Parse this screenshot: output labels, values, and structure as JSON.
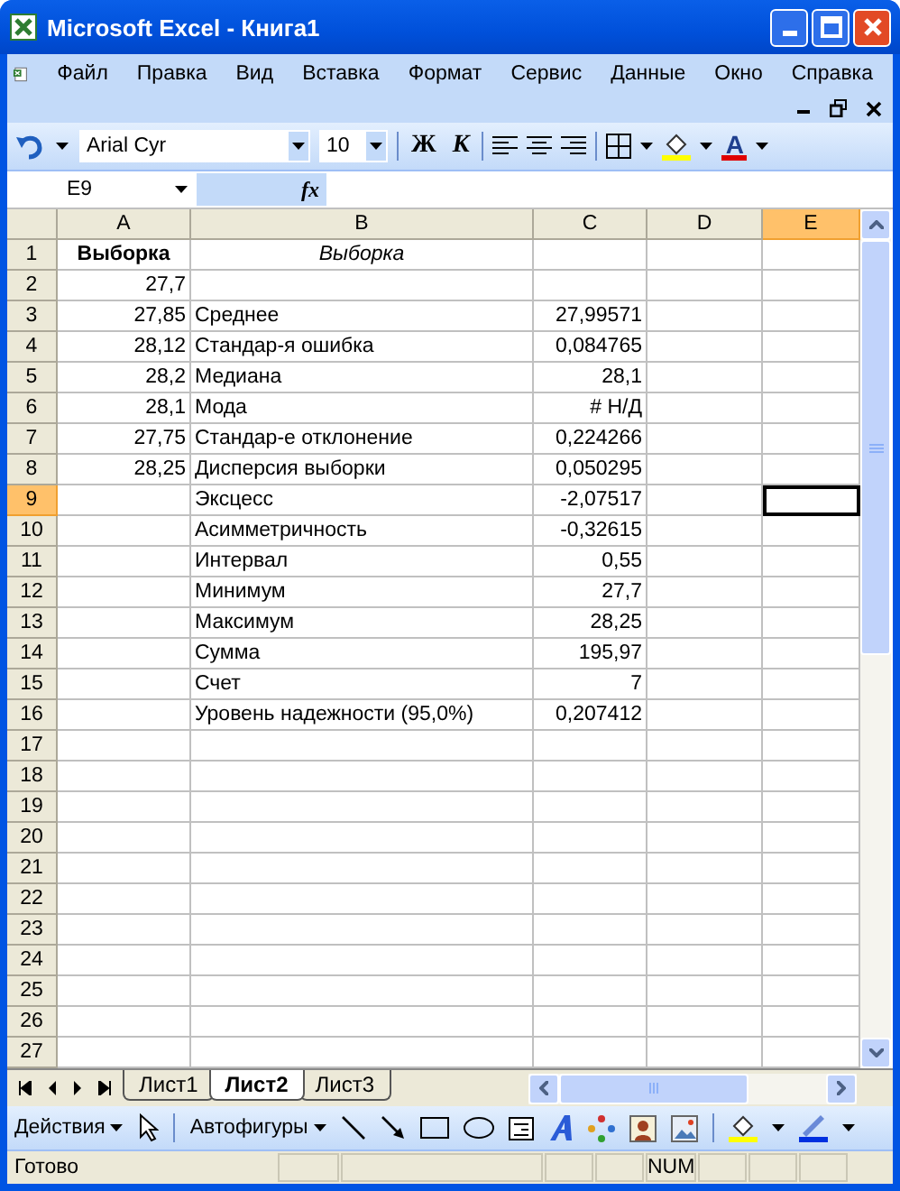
{
  "window": {
    "title": "Microsoft Excel - Книга1"
  },
  "menu": [
    "Файл",
    "Правка",
    "Вид",
    "Вставка",
    "Формат",
    "Сервис",
    "Данные",
    "Окно",
    "Справка"
  ],
  "toolbar": {
    "font": "Arial Cyr",
    "size": "10",
    "bold": "Ж",
    "italic": "К",
    "font_color": "A"
  },
  "formula_bar": {
    "name_box": "E9",
    "fx": "fx"
  },
  "columns": [
    {
      "label": "A",
      "selected": false
    },
    {
      "label": "B",
      "selected": false
    },
    {
      "label": "C",
      "selected": false
    },
    {
      "label": "D",
      "selected": false
    },
    {
      "label": "E",
      "selected": true
    }
  ],
  "rows": [
    {
      "number": "1",
      "selected": false,
      "a": {
        "text": "Выборка",
        "kind": "bold_center"
      },
      "b": {
        "text": "Выборка",
        "kind": "italic_center"
      }
    },
    {
      "number": "2",
      "selected": false,
      "a": {
        "text": "27,7",
        "kind": "number"
      }
    },
    {
      "number": "3",
      "selected": false,
      "a": {
        "text": "27,85",
        "kind": "number"
      },
      "b": {
        "text": "Среднее",
        "kind": "text"
      },
      "c": {
        "text": "27,99571",
        "kind": "number"
      }
    },
    {
      "number": "4",
      "selected": false,
      "a": {
        "text": "28,12",
        "kind": "number"
      },
      "b": {
        "text": "Стандар-я ошибка",
        "kind": "text"
      },
      "c": {
        "text": "0,084765",
        "kind": "number"
      }
    },
    {
      "number": "5",
      "selected": false,
      "a": {
        "text": "28,2",
        "kind": "number"
      },
      "b": {
        "text": "Медиана",
        "kind": "text"
      },
      "c": {
        "text": "28,1",
        "kind": "number"
      }
    },
    {
      "number": "6",
      "selected": false,
      "a": {
        "text": "28,1",
        "kind": "number"
      },
      "b": {
        "text": "Мода",
        "kind": "text"
      },
      "c": {
        "text": "# Н/Д",
        "kind": "number"
      }
    },
    {
      "number": "7",
      "selected": false,
      "a": {
        "text": "27,75",
        "kind": "number"
      },
      "b": {
        "text": "Стандар-е отклонение",
        "kind": "text"
      },
      "c": {
        "text": "0,224266",
        "kind": "number"
      }
    },
    {
      "number": "8",
      "selected": false,
      "a": {
        "text": "28,25",
        "kind": "number"
      },
      "b": {
        "text": "Дисперсия выборки",
        "kind": "text"
      },
      "c": {
        "text": "0,050295",
        "kind": "number"
      }
    },
    {
      "number": "9",
      "selected": true,
      "b": {
        "text": "Эксцесс",
        "kind": "text"
      },
      "c": {
        "text": "-2,07517",
        "kind": "number"
      }
    },
    {
      "number": "10",
      "selected": false,
      "b": {
        "text": "Асимметричность",
        "kind": "text"
      },
      "c": {
        "text": "-0,32615",
        "kind": "number"
      }
    },
    {
      "number": "11",
      "selected": false,
      "b": {
        "text": "Интервал",
        "kind": "text"
      },
      "c": {
        "text": "0,55",
        "kind": "number"
      }
    },
    {
      "number": "12",
      "selected": false,
      "b": {
        "text": "Минимум",
        "kind": "text"
      },
      "c": {
        "text": "27,7",
        "kind": "number"
      }
    },
    {
      "number": "13",
      "selected": false,
      "b": {
        "text": "Максимум",
        "kind": "text"
      },
      "c": {
        "text": "28,25",
        "kind": "number"
      }
    },
    {
      "number": "14",
      "selected": false,
      "b": {
        "text": "Сумма",
        "kind": "text"
      },
      "c": {
        "text": "195,97",
        "kind": "number"
      }
    },
    {
      "number": "15",
      "selected": false,
      "b": {
        "text": "Счет",
        "kind": "text"
      },
      "c": {
        "text": "7",
        "kind": "number"
      }
    },
    {
      "number": "16",
      "selected": false,
      "b": {
        "text": "Уровень надежности (95,0%)",
        "kind": "text"
      },
      "c": {
        "text": "0,207412",
        "kind": "number"
      }
    },
    {
      "number": "17",
      "selected": false
    },
    {
      "number": "18",
      "selected": false
    },
    {
      "number": "19",
      "selected": false
    },
    {
      "number": "20",
      "selected": false
    },
    {
      "number": "21",
      "selected": false
    },
    {
      "number": "22",
      "selected": false
    },
    {
      "number": "23",
      "selected": false
    },
    {
      "number": "24",
      "selected": false
    },
    {
      "number": "25",
      "selected": false
    },
    {
      "number": "26",
      "selected": false
    },
    {
      "number": "27",
      "selected": false
    }
  ],
  "sheet_tabs": [
    {
      "label": "Лист1",
      "selected": false
    },
    {
      "label": "Лист2",
      "selected": true
    },
    {
      "label": "Лист3",
      "selected": false
    }
  ],
  "drawing_toolbar": {
    "actions": "Действия",
    "autoshapes": "Автофигуры"
  },
  "status_bar": {
    "text": "Готово",
    "num": "NUM"
  }
}
